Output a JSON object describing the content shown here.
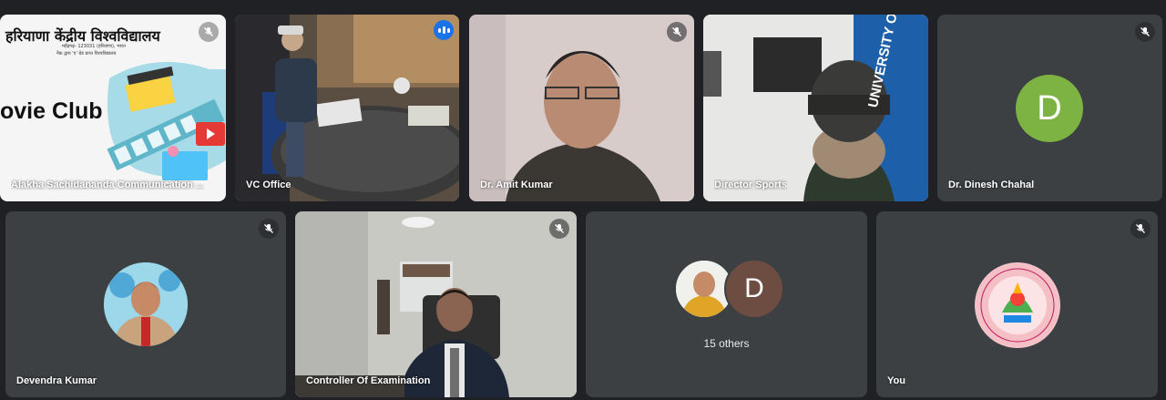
{
  "tiles": [
    {
      "name": "Alakha Sachidananda Communication ...",
      "title_hindi": "हरियाणा केंद्रीय विश्वविद्यालय",
      "sub1": "महेंद्रगढ़- 123031 (हरियाणा), भारत",
      "sub2": "नैक द्वारा 'ए' ग्रेड प्राप्त विश्वविद्यालय",
      "slide_text": "ovie Club"
    },
    {
      "name": "VC Office"
    },
    {
      "name": "Dr. Amit Kumar"
    },
    {
      "name": "Director Sports",
      "banner_text": "UNIVERSITY OF"
    },
    {
      "name": "Dr. Dinesh Chahal",
      "initial": "D",
      "color": "#7cb342"
    },
    {
      "name": "Devendra Kumar"
    },
    {
      "name": "Controller Of Examination"
    },
    {
      "name": "",
      "initial": "D",
      "color": "#6d4c41",
      "others_label": "15 others"
    },
    {
      "name": "You"
    }
  ],
  "colors": {
    "background": "#202124",
    "tile": "#3c4043",
    "active_border": "#8ab4f8",
    "speaking": "#1a73e8"
  }
}
